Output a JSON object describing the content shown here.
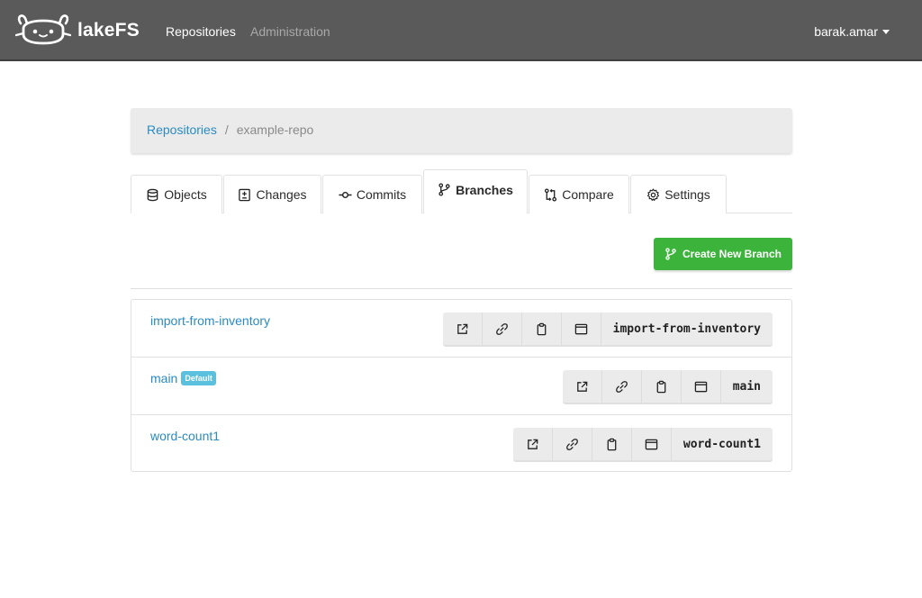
{
  "navbar": {
    "brand": "lakeFS",
    "links": [
      {
        "label": "Repositories"
      },
      {
        "label": "Administration"
      }
    ],
    "user": "barak.amar"
  },
  "breadcrumb": {
    "root": "Repositories",
    "separator": "/",
    "current": "example-repo"
  },
  "tabs": [
    {
      "label": "Objects",
      "icon": "database-icon"
    },
    {
      "label": "Changes",
      "icon": "diff-icon"
    },
    {
      "label": "Commits",
      "icon": "commit-icon"
    },
    {
      "label": "Branches",
      "icon": "git-branch-icon",
      "active": true
    },
    {
      "label": "Compare",
      "icon": "git-compare-icon"
    },
    {
      "label": "Settings",
      "icon": "gear-icon"
    }
  ],
  "create_button": {
    "label": "Create New Branch",
    "icon": "git-branch-icon"
  },
  "branches": [
    {
      "name": "import-from-inventory",
      "badge": "",
      "ref": "import-from-inventory"
    },
    {
      "name": "main",
      "badge": "Default",
      "ref": "main"
    },
    {
      "name": "word-count1",
      "badge": "",
      "ref": "word-count1"
    }
  ],
  "colors": {
    "navbar": "#5a5a5a",
    "link": "#2a8bc3",
    "create_button": "#3cb43c",
    "badge": "#5bc0de"
  }
}
